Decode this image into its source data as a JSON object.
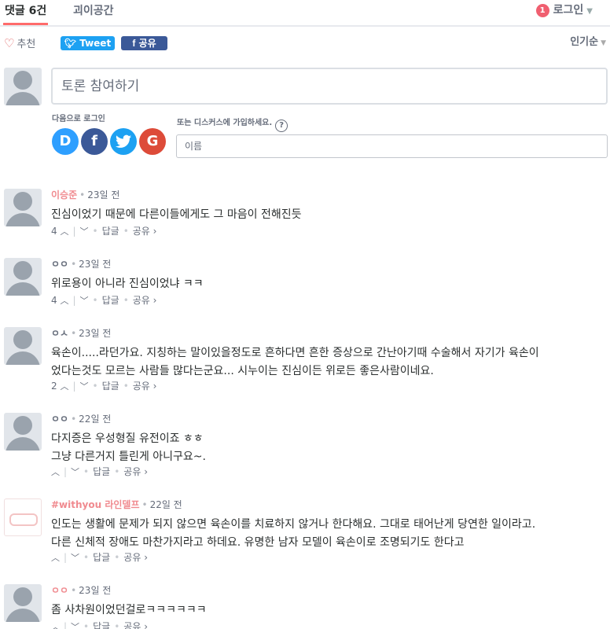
{
  "header": {
    "tab_comments": "댓글 6건",
    "tab_community": "괴이공간",
    "notification_count": "1",
    "login_label": "로그인"
  },
  "actions": {
    "recommend_label": "추천",
    "tweet_label": "Tweet",
    "share_label": "공유",
    "sort_label": "인기순"
  },
  "composer": {
    "placeholder": "토론 참여하기",
    "login_with_label": "다음으로 로그인",
    "social": [
      "D",
      "f",
      "t",
      "G"
    ],
    "signup_label": "또는 디스커스에 가입하세요.",
    "help_label": "?",
    "name_placeholder": "이름"
  },
  "comments": [
    {
      "author": "이승준",
      "time": "23일 전",
      "lines": [
        "진심이었기 때문에 다른이들에게도 그 마음이 전해진듯"
      ],
      "votes": "4",
      "reply": "답글",
      "share": "공유 ›"
    },
    {
      "author": "ㅇㅇ",
      "time": "23일 전",
      "lines": [
        "위로용이 아니라 진심이었냐 ㅋㅋ"
      ],
      "votes": "4",
      "reply": "답글",
      "share": "공유 ›"
    },
    {
      "author": "ㅇㅅ",
      "time": "23일 전",
      "lines": [
        "육손이.....라던가요. 지칭하는 말이있을정도로 흔하다면 흔한 증상으로 간난아기때 수술해서 자기가 육손이",
        "었다는것도 모르는 사람들 많다는군요... 시누이는 진심이든 위로든 좋은사람이네요."
      ],
      "votes": "2",
      "reply": "답글",
      "share": "공유 ›"
    },
    {
      "author": "ㅇㅇ",
      "time": "22일 전",
      "lines": [
        "다지증은 우성형질 유전이죠 ㅎㅎ",
        "그냥 다른거지 틀린게 아니구요~."
      ],
      "votes": "",
      "reply": "답글",
      "share": "공유 ›"
    },
    {
      "author": "#withyou 라인델프",
      "time": "22일 전",
      "lines": [
        "인도는 생활에 문제가 되지 않으면 육손이를 치료하지 않거나 한다해요. 그대로 태어난게 당연한 일이라고.",
        "다른 신체적 장애도 마찬가지라고 하데요. 유명한 남자 모델이 육손이로 조명되기도 한다고"
      ],
      "votes": "",
      "reply": "답글",
      "share": "공유 ›"
    },
    {
      "author": "ㅇㅇ",
      "time": "23일 전",
      "lines": [
        "좀 사차원이었던걸로ㅋㅋㅋㅋㅋㅋ"
      ],
      "votes": "",
      "reply": "답글",
      "share": "공유 ›"
    }
  ],
  "colors": {
    "accent_red": "#ff6b6b",
    "twitter": "#1da1f2",
    "facebook": "#3b5998",
    "disqus": "#2e9fff",
    "google": "#dd4b39",
    "text": "#2a2e2e",
    "muted": "#656c7a"
  }
}
